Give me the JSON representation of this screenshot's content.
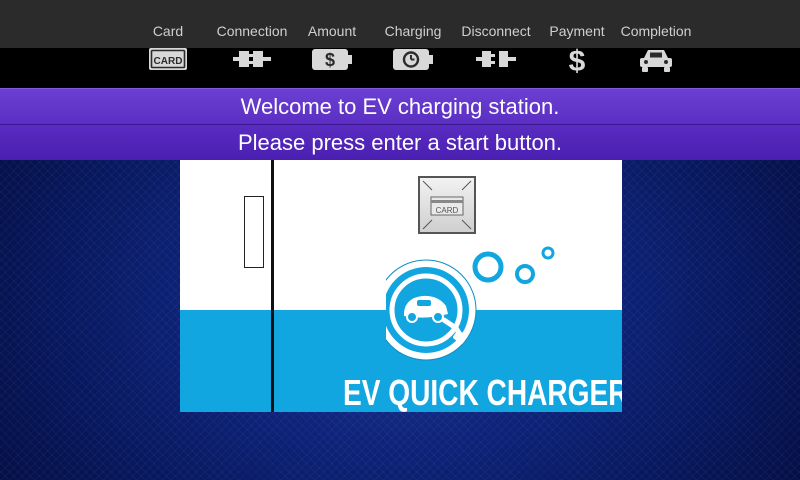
{
  "steps": [
    {
      "label": "Card",
      "icon": "card-icon"
    },
    {
      "label": "Connection",
      "icon": "plug-connect-icon"
    },
    {
      "label": "Amount",
      "icon": "dollar-battery-icon"
    },
    {
      "label": "Charging",
      "icon": "clock-battery-icon"
    },
    {
      "label": "Disconnect",
      "icon": "plug-disconnect-icon"
    },
    {
      "label": "Payment",
      "icon": "dollar-icon"
    },
    {
      "label": "Completion",
      "icon": "car-icon"
    }
  ],
  "card_icon_text": "CARD",
  "banner": {
    "line1": "Welcome to EV charging station.",
    "line2": "Please press enter a start button."
  },
  "charger": {
    "reader_label": "CARD",
    "title": "EV QUICK CHARGER"
  },
  "colors": {
    "banner_purple": "#5b2fc3",
    "charger_blue": "#12a6e0",
    "background_navy": "#0e237a"
  }
}
